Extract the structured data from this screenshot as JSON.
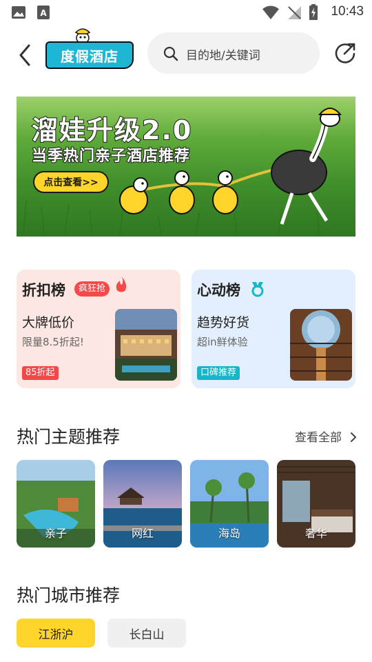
{
  "status_bar": {
    "time": "10:43"
  },
  "header": {
    "brand_label": "度假酒店",
    "search_placeholder": "目的地/关键词"
  },
  "banner": {
    "title": "溜娃升级2.0",
    "subtitle": "当季热门亲子酒店推荐",
    "cta": "点击查看>>"
  },
  "rank_cards": [
    {
      "title": "折扣榜",
      "tag": "疯狂抢",
      "headline": "大牌低价",
      "desc": "限量8.5折起!",
      "badge": "85折起"
    },
    {
      "title": "心动榜",
      "headline": "趋势好货",
      "desc": "超in鲜体验",
      "badge": "口碑推荐"
    }
  ],
  "themes": {
    "heading": "热门主题推荐",
    "more_label": "查看全部",
    "items": [
      {
        "label": "亲子"
      },
      {
        "label": "网红"
      },
      {
        "label": "海岛"
      },
      {
        "label": "奢华"
      }
    ]
  },
  "cities": {
    "heading": "热门城市推荐",
    "chips": [
      {
        "label": "江浙沪",
        "selected": true
      },
      {
        "label": "长白山",
        "selected": false
      }
    ]
  },
  "colors": {
    "accent_yellow": "#ffd52b",
    "brand_cyan": "#1fb6d3",
    "discount_red": "#f2484a",
    "heart_teal": "#16b6c8"
  }
}
